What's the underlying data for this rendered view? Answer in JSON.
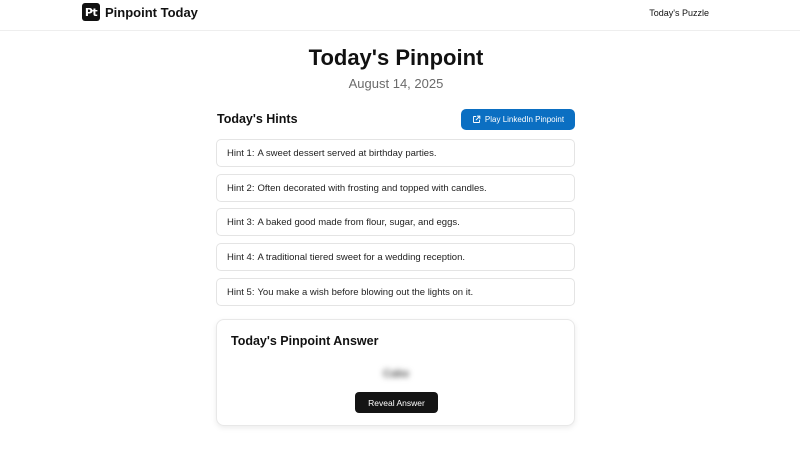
{
  "header": {
    "logo_text": "Pt",
    "brand": "Pinpoint Today",
    "nav_link": "Today's Puzzle"
  },
  "main": {
    "title": "Today's Pinpoint",
    "date": "August 14, 2025"
  },
  "hints": {
    "title": "Today's Hints",
    "play_button": "Play LinkedIn Pinpoint",
    "items": [
      {
        "label": "Hint 1:",
        "text": "A sweet dessert served at birthday parties."
      },
      {
        "label": "Hint 2:",
        "text": "Often decorated with frosting and topped with candles."
      },
      {
        "label": "Hint 3:",
        "text": "A baked good made from flour, sugar, and eggs."
      },
      {
        "label": "Hint 4:",
        "text": "A traditional tiered sweet for a wedding reception."
      },
      {
        "label": "Hint 5:",
        "text": "You make a wish before blowing out the lights on it."
      }
    ]
  },
  "answer": {
    "title": "Today's Pinpoint Answer",
    "hidden_answer": "Cake",
    "reveal_button": "Reveal Answer"
  },
  "colors": {
    "play_button": "#0b6fc2",
    "reveal_button": "#141414"
  },
  "icons": {
    "external_link": "external-link-icon"
  }
}
